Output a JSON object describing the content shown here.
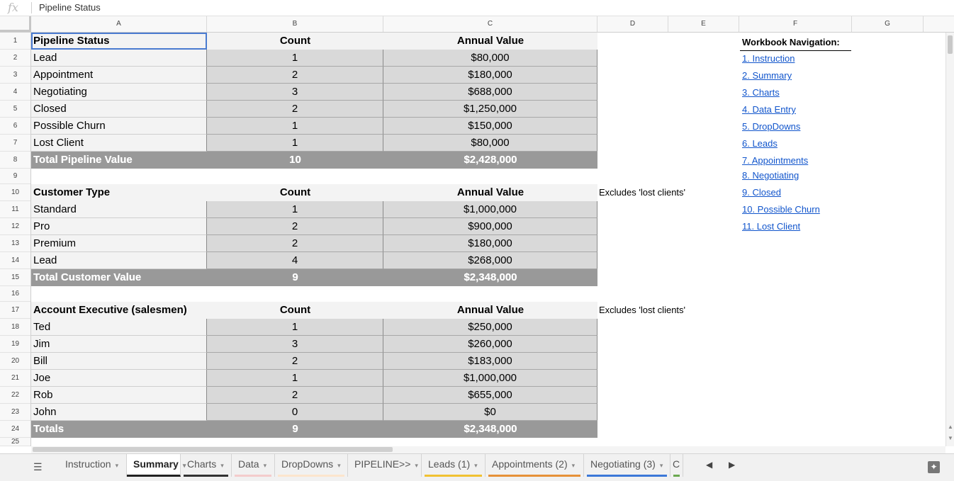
{
  "formula_bar": {
    "fx": "fx",
    "value": "Pipeline Status"
  },
  "columns": [
    "A",
    "B",
    "C",
    "D",
    "E",
    "F",
    "G"
  ],
  "rows": [
    "1",
    "2",
    "3",
    "4",
    "5",
    "6",
    "7",
    "8",
    "9",
    "10",
    "11",
    "12",
    "13",
    "14",
    "15",
    "16",
    "17",
    "18",
    "19",
    "20",
    "21",
    "22",
    "23",
    "24",
    "25"
  ],
  "pipeline": {
    "header": [
      "Pipeline Status",
      "Count",
      "Annual Value"
    ],
    "rows": [
      [
        "Lead",
        "1",
        "$80,000"
      ],
      [
        "Appointment",
        "2",
        "$180,000"
      ],
      [
        "Negotiating",
        "3",
        "$688,000"
      ],
      [
        "Closed",
        "2",
        "$1,250,000"
      ],
      [
        "Possible Churn",
        "1",
        "$150,000"
      ],
      [
        "Lost Client",
        "1",
        "$80,000"
      ]
    ],
    "total": [
      "Total Pipeline Value",
      "10",
      "$2,428,000"
    ]
  },
  "customer": {
    "header": [
      "Customer Type",
      "Count",
      "Annual Value"
    ],
    "note": "Excludes 'lost clients'",
    "rows": [
      [
        "Standard",
        "1",
        "$1,000,000"
      ],
      [
        "Pro",
        "2",
        "$900,000"
      ],
      [
        "Premium",
        "2",
        "$180,000"
      ],
      [
        "Lead",
        "4",
        "$268,000"
      ]
    ],
    "total": [
      "Total Customer Value",
      "9",
      "$2,348,000"
    ]
  },
  "salesmen": {
    "header": [
      "Account Executive (salesmen)",
      "Count",
      "Annual Value"
    ],
    "note": "Excludes 'lost clients'",
    "rows": [
      [
        "Ted",
        "1",
        "$250,000"
      ],
      [
        "Jim",
        "3",
        "$260,000"
      ],
      [
        "Bill",
        "2",
        "$183,000"
      ],
      [
        "Joe",
        "1",
        "$1,000,000"
      ],
      [
        "Rob",
        "2",
        "$655,000"
      ],
      [
        "John",
        "0",
        "$0"
      ]
    ],
    "total": [
      "Totals",
      "9",
      "$2,348,000"
    ]
  },
  "navigation": {
    "title": "Workbook Navigation:",
    "links": [
      "1. Instruction",
      "2. Summary",
      "3. Charts",
      "4. Data Entry",
      "5. DropDowns",
      "6. Leads",
      "7. Appointments",
      "8. Negotiating",
      "9. Closed",
      "10. Possible Churn",
      "11. Lost Client"
    ]
  },
  "sheet_tabs": [
    {
      "label": "Instruction",
      "color": ""
    },
    {
      "label": "Summary",
      "color": "",
      "active": true
    },
    {
      "label": "Charts",
      "color": "#333333"
    },
    {
      "label": "Data",
      "color": "#f4cccc"
    },
    {
      "label": "DropDowns",
      "color": "#fce5cd"
    },
    {
      "label": "PIPELINE>>",
      "color": ""
    },
    {
      "label": "Leads (1)",
      "color": "#f1c232"
    },
    {
      "label": "Appointments (2)",
      "color": "#e69138"
    },
    {
      "label": "Negotiating (3)",
      "color": "#3c78d8"
    },
    {
      "label": "C",
      "color": "#6aa84f"
    }
  ],
  "icons": {
    "all_sheets": "all-sheets-menu-icon",
    "tab_left": "tab-scroll-left-icon",
    "tab_right": "tab-scroll-right-icon",
    "explore": "explore-icon",
    "tab_caret": "chevron-down-icon"
  },
  "glyphs": {
    "menu": "☰",
    "left": "◀",
    "right": "▶",
    "explore": "✦",
    "caret": "▾",
    "up": "▲",
    "down": "▼"
  }
}
